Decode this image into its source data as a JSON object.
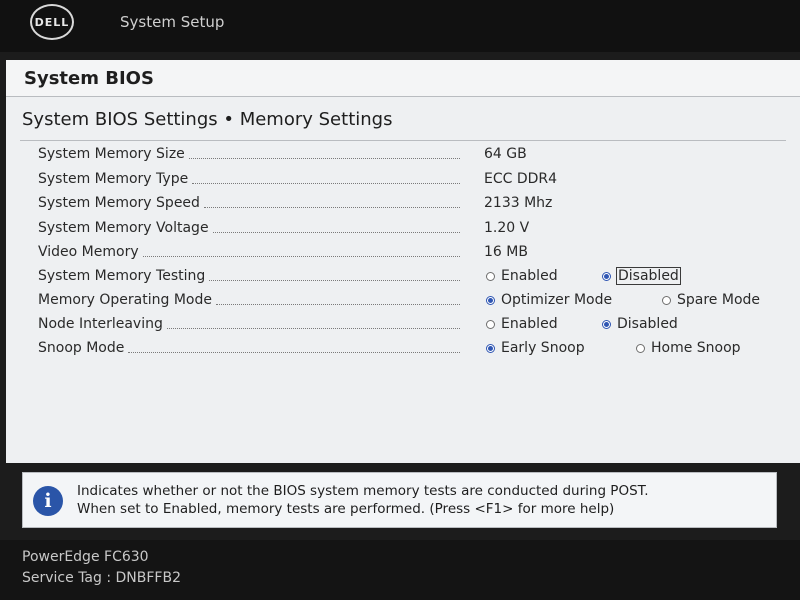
{
  "header": {
    "logo_text": "DELL",
    "app_title": "System Setup"
  },
  "panel": {
    "title": "System BIOS",
    "section_title": "System BIOS Settings • Memory Settings"
  },
  "settings": {
    "memory_size": {
      "label": "System Memory Size",
      "value": "64 GB"
    },
    "memory_type": {
      "label": "System Memory Type",
      "value": "ECC DDR4"
    },
    "memory_speed": {
      "label": "System Memory Speed",
      "value": "2133 Mhz"
    },
    "memory_voltage": {
      "label": "System Memory Voltage",
      "value": "1.20 V"
    },
    "video_memory": {
      "label": "Video Memory",
      "value": "16 MB"
    },
    "memory_testing": {
      "label": "System Memory Testing",
      "options": [
        "Enabled",
        "Disabled"
      ],
      "selected": "Disabled"
    },
    "operating_mode": {
      "label": "Memory Operating Mode",
      "options": [
        "Optimizer Mode",
        "Spare Mode"
      ],
      "selected": "Optimizer Mode"
    },
    "node_interleaving": {
      "label": "Node Interleaving",
      "options": [
        "Enabled",
        "Disabled"
      ],
      "selected": "Disabled"
    },
    "snoop_mode": {
      "label": "Snoop Mode",
      "options": [
        "Early Snoop",
        "Home Snoop"
      ],
      "selected": "Early Snoop"
    }
  },
  "help": {
    "line1": "Indicates whether or not the BIOS system memory tests are conducted during POST.",
    "line2": "When set to Enabled, memory tests are performed. (Press <F1> for more help)"
  },
  "footer": {
    "model": "PowerEdge FC630",
    "service_tag": "Service Tag : DNBFFB2"
  },
  "colors": {
    "accent": "#2f56b3",
    "panel_bg": "#eef0f2",
    "chrome_bg": "#141414"
  }
}
